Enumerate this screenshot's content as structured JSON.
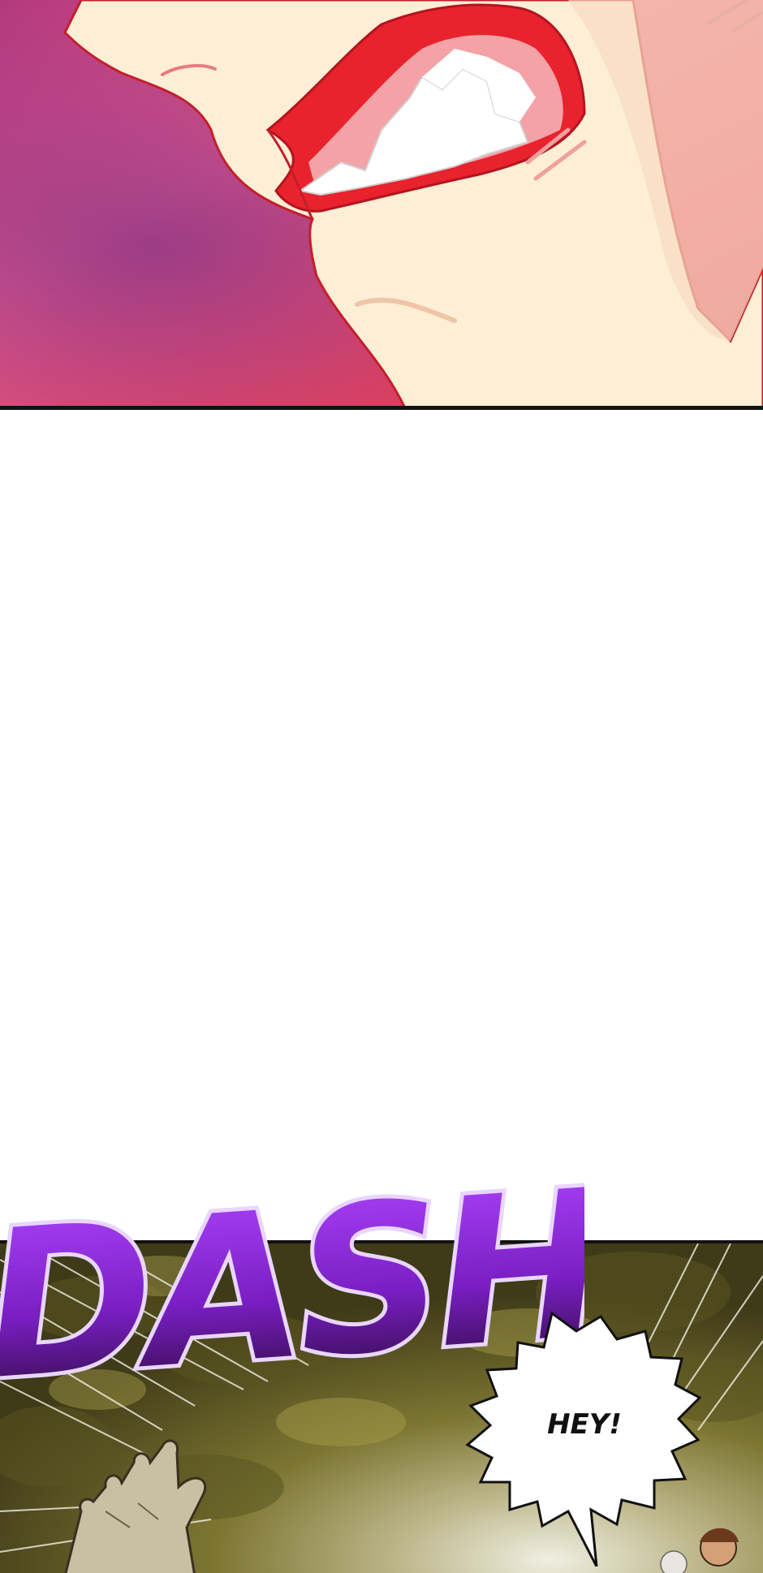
{
  "panels": [
    {
      "id": "top",
      "description_id": "grinning-face-closeup"
    },
    {
      "id": "bottom",
      "description_id": "forest-speed-lines"
    }
  ],
  "sfx": {
    "text": "DASH",
    "color": "#9b30e8"
  },
  "speech_bubble": {
    "text": "HEY!"
  },
  "colors": {
    "skin": "#fdeed6",
    "skin_shadow": "#f7dcc0",
    "mouth_red": "#e8232e",
    "gum_pink": "#f3a2a6",
    "bg_magenta": "#e84a7a",
    "bg_purple": "#8a3a8e",
    "forest_olive": "#6e6a2a",
    "forest_dark": "#3a3616",
    "sfx_purple": "#9b30e8",
    "sfx_dark": "#2b0a3d"
  }
}
